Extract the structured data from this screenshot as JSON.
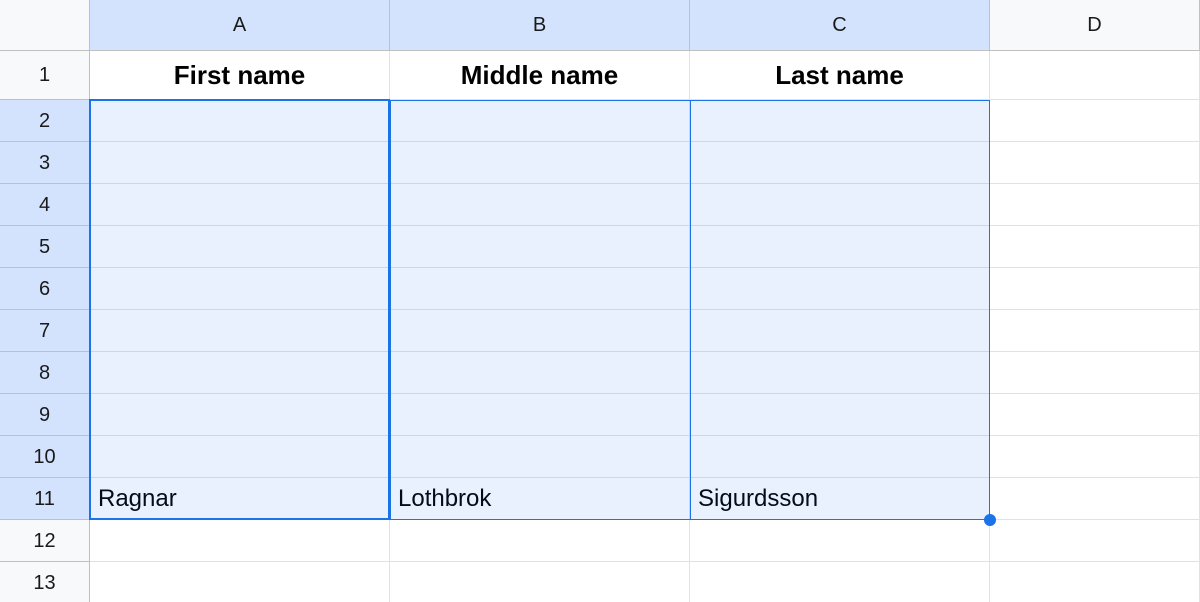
{
  "columns": [
    {
      "letter": "A",
      "selected": true
    },
    {
      "letter": "B",
      "selected": true
    },
    {
      "letter": "C",
      "selected": true
    },
    {
      "letter": "D",
      "selected": false
    }
  ],
  "rows": [
    {
      "n": "1",
      "selected": false
    },
    {
      "n": "2",
      "selected": true
    },
    {
      "n": "3",
      "selected": true
    },
    {
      "n": "4",
      "selected": true
    },
    {
      "n": "5",
      "selected": true
    },
    {
      "n": "6",
      "selected": true
    },
    {
      "n": "7",
      "selected": true
    },
    {
      "n": "8",
      "selected": true
    },
    {
      "n": "9",
      "selected": true
    },
    {
      "n": "10",
      "selected": true
    },
    {
      "n": "11",
      "selected": true
    },
    {
      "n": "12",
      "selected": false
    },
    {
      "n": "13",
      "selected": false
    }
  ],
  "header_row": {
    "A": "First name",
    "B": "Middle name",
    "C": "Last name"
  },
  "data_row11": {
    "A": "Ragnar",
    "B": "Lothbrok",
    "C": "Sigurdsson"
  },
  "selection": "A2:C11",
  "active_cell": "A2"
}
